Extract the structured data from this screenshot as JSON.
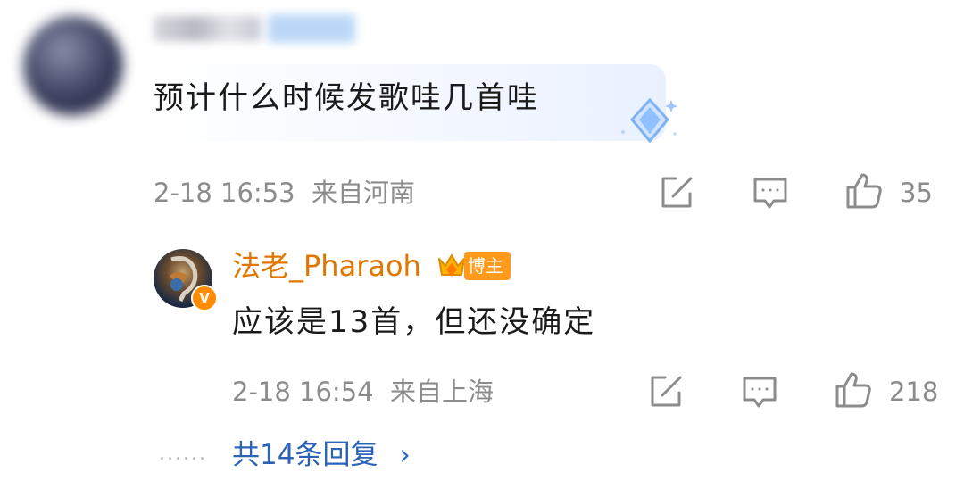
{
  "comment": {
    "text": "预计什么时候发歌哇几首哇",
    "date": "2-18 16:53",
    "location": "来自河南",
    "like_count": "35",
    "icons": {
      "sticker": "diamond-sticker-icon",
      "share": "share-icon",
      "reply": "comment-icon",
      "like": "thumbs-up-icon"
    }
  },
  "reply": {
    "author": "法老_Pharaoh",
    "verified_badge": "V",
    "role_badge": "博主",
    "text": "应该是13首，但还没确定",
    "date": "2-18 16:54",
    "location": "来自上海",
    "like_count": "218"
  },
  "more": {
    "dots": "......",
    "label": "共14条回复",
    "chevron": "›"
  },
  "colors": {
    "author": "#e07800",
    "link": "#2a64b8",
    "meta": "#8c8c8c",
    "badge": "#ff9a1a"
  }
}
